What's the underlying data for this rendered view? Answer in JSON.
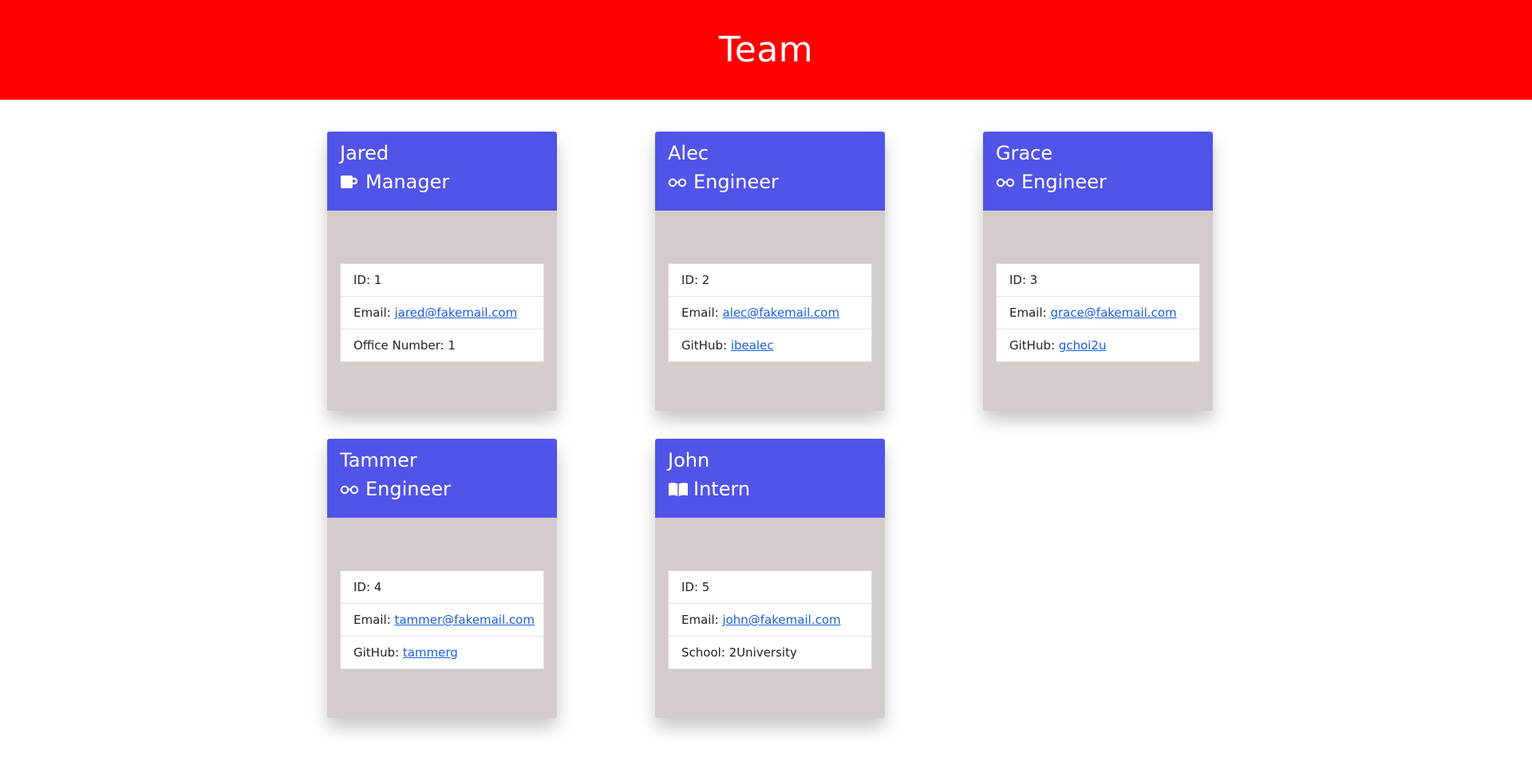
{
  "header": {
    "title": "Team"
  },
  "colors": {
    "banner": "#ff0000",
    "card_header": "#5154e8",
    "card_body": "#d4cbcb",
    "link": "#1a5fe0"
  },
  "labels": {
    "id": "ID: ",
    "email": "Email: ",
    "office": "Office Number: ",
    "github": "GitHub: ",
    "school": "School: "
  },
  "members": [
    {
      "name": "Jared",
      "role": "Manager",
      "icon": "mug-icon",
      "id": "1",
      "email": "jared@fakemail.com",
      "extra_label": "Office Number: ",
      "extra_value": "1",
      "extra_is_link": false
    },
    {
      "name": "Alec",
      "role": "Engineer",
      "icon": "glasses-icon",
      "id": "2",
      "email": "alec@fakemail.com",
      "extra_label": "GitHub: ",
      "extra_value": "ibealec",
      "extra_is_link": true
    },
    {
      "name": "Grace",
      "role": "Engineer",
      "icon": "glasses-icon",
      "id": "3",
      "email": "grace@fakemail.com",
      "extra_label": "GitHub: ",
      "extra_value": "gchoi2u",
      "extra_is_link": true
    },
    {
      "name": "Tammer",
      "role": "Engineer",
      "icon": "glasses-icon",
      "id": "4",
      "email": "tammer@fakemail.com",
      "extra_label": "GitHub: ",
      "extra_value": "tammerg",
      "extra_is_link": true
    },
    {
      "name": "John",
      "role": "Intern",
      "icon": "book-icon",
      "id": "5",
      "email": "john@fakemail.com",
      "extra_label": "School: ",
      "extra_value": "2University",
      "extra_is_link": false
    }
  ]
}
